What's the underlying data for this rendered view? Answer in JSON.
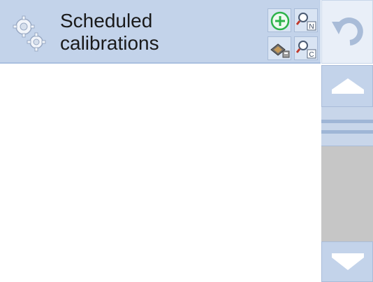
{
  "header": {
    "title_line1": "Scheduled",
    "title_line2": "calibrations",
    "icons": {
      "header": "gears-icon",
      "add": "add-circle-icon",
      "search_n": "search-n-icon",
      "print": "print-icon",
      "search_c": "search-c-icon"
    },
    "search_n_letter": "N",
    "search_c_letter": "C"
  },
  "nav": {
    "undo_icon": "undo-arrow-icon",
    "scroll_up_icon": "scroll-up-arrow-icon",
    "scroll_down_icon": "scroll-down-arrow-icon"
  },
  "colors": {
    "header_bg": "#c3d3ea",
    "accent_green": "#2db34a",
    "scroll_track": "#c6c6c6"
  },
  "list": {
    "items": []
  }
}
